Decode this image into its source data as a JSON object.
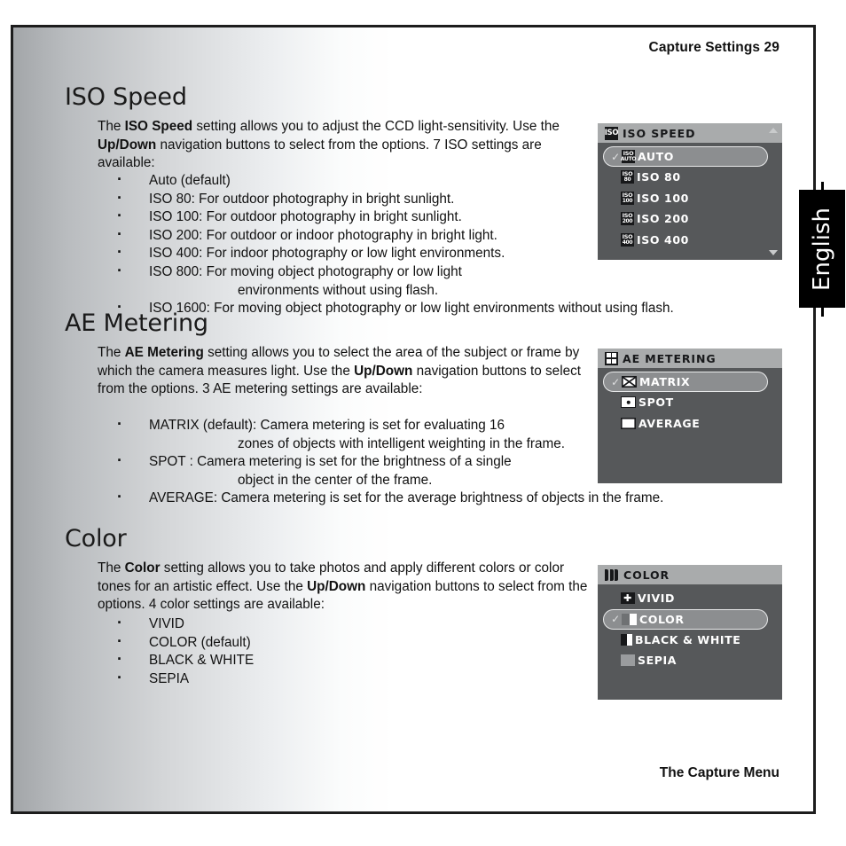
{
  "header": {
    "title": "Capture Settings  29"
  },
  "footer": {
    "title": "The Capture Menu"
  },
  "side_tab": {
    "label": "English"
  },
  "sections": [
    {
      "heading": "ISO Speed",
      "paragraph_parts": [
        {
          "t": "The ",
          "b": false
        },
        {
          "t": "ISO Speed",
          "b": true
        },
        {
          "t": " setting allows you to adjust the CCD light-sensitivity. Use the ",
          "b": false
        },
        {
          "t": "Up/Down",
          "b": true
        },
        {
          "t": " navigation buttons to select from the options. 7 ISO settings are available:",
          "b": false
        }
      ],
      "bullets": [
        {
          "main": "Auto (default)",
          "hang": ""
        },
        {
          "main": "ISO 80: For outdoor photography in bright sunlight.",
          "hang": ""
        },
        {
          "main": "ISO 100: For outdoor photography in bright sunlight.",
          "hang": ""
        },
        {
          "main": "ISO 200: For outdoor or indoor photography in bright light.",
          "hang": ""
        },
        {
          "main": "ISO 400: For indoor photography or low light environments.",
          "hang": ""
        },
        {
          "main": "ISO 800: For moving object photography or low light",
          "hang": "environments without using flash."
        },
        {
          "main": "ISO 1600: For moving object photography or low light environments without using flash.",
          "hang": ""
        }
      ]
    },
    {
      "heading": "AE Metering",
      "paragraph_parts": [
        {
          "t": "The ",
          "b": false
        },
        {
          "t": "AE Metering",
          "b": true
        },
        {
          "t": " setting allows you to select the area of the subject or frame by which the camera measures light. Use the ",
          "b": false
        },
        {
          "t": "Up/Down",
          "b": true
        },
        {
          "t": " navigation buttons to select from the options. 3 AE metering settings are available:",
          "b": false
        }
      ],
      "bullets": [
        {
          "main": "MATRIX (default): Camera metering is set for evaluating 16",
          "hang": "zones of objects with intelligent weighting in the frame."
        },
        {
          "main": "SPOT : Camera metering is set for the brightness of a single",
          "hang": "object in the center of the frame."
        },
        {
          "main": "AVERAGE: Camera metering is set for the average brightness of objects in the frame.",
          "hang": ""
        }
      ]
    },
    {
      "heading": "Color",
      "paragraph_parts": [
        {
          "t": "The ",
          "b": false
        },
        {
          "t": "Color",
          "b": true
        },
        {
          "t": " setting allows you to take photos and apply different colors or color tones for an artistic effect. Use the ",
          "b": false
        },
        {
          "t": "Up/Down",
          "b": true
        },
        {
          "t": " navigation buttons to select from the options. 4 color settings are available:",
          "b": false
        }
      ],
      "bullets": [
        {
          "main": "VIVID",
          "hang": ""
        },
        {
          "main": "COLOR (default)",
          "hang": ""
        },
        {
          "main": "BLACK & WHITE",
          "hang": ""
        },
        {
          "main": "SEPIA",
          "hang": ""
        }
      ]
    }
  ],
  "osd_panels": [
    {
      "id": "iso-speed",
      "title": "ISO SPEED",
      "title_icon": "iso-badge-icon",
      "has_scrollbar": true,
      "items": [
        {
          "label": "AUTO",
          "icon": "iso-auto-badge-icon",
          "icon_top": "ISO",
          "icon_bottom": "AUTO",
          "selected": true
        },
        {
          "label": "ISO 80",
          "icon": "iso-80-badge-icon",
          "icon_top": "ISO",
          "icon_bottom": "80",
          "selected": false
        },
        {
          "label": "ISO 100",
          "icon": "iso-100-badge-icon",
          "icon_top": "ISO",
          "icon_bottom": "100",
          "selected": false
        },
        {
          "label": "ISO 200",
          "icon": "iso-200-badge-icon",
          "icon_top": "ISO",
          "icon_bottom": "200",
          "selected": false
        },
        {
          "label": "ISO 400",
          "icon": "iso-400-badge-icon",
          "icon_top": "ISO",
          "icon_bottom": "400",
          "selected": false
        }
      ]
    },
    {
      "id": "ae-metering",
      "title": "AE METERING",
      "title_icon": "four-square-grid-icon",
      "has_scrollbar": false,
      "items": [
        {
          "label": "MATRIX",
          "icon": "matrix-x-box-icon",
          "selected": true
        },
        {
          "label": "SPOT",
          "icon": "spot-dot-box-icon",
          "selected": false
        },
        {
          "label": "AVERAGE",
          "icon": "average-half-box-icon",
          "selected": false
        }
      ]
    },
    {
      "id": "color",
      "title": "COLOR",
      "title_icon": "color-bars-icon",
      "has_scrollbar": false,
      "items": [
        {
          "label": "VIVID",
          "icon": "vivid-plus-box-icon",
          "selected": false
        },
        {
          "label": "COLOR",
          "icon": "color-half-box-icon",
          "selected": true
        },
        {
          "label": "BLACK & WHITE",
          "icon": "bw-half-box-icon",
          "selected": false
        },
        {
          "label": "SEPIA",
          "icon": "sepia-box-icon",
          "selected": false
        }
      ]
    }
  ],
  "colors": {
    "osd_body": "#56585a",
    "osd_title_bar": "#a9abac",
    "osd_selected": "#8c8e90",
    "page_border": "#1d1d1d",
    "text": "#111111"
  }
}
